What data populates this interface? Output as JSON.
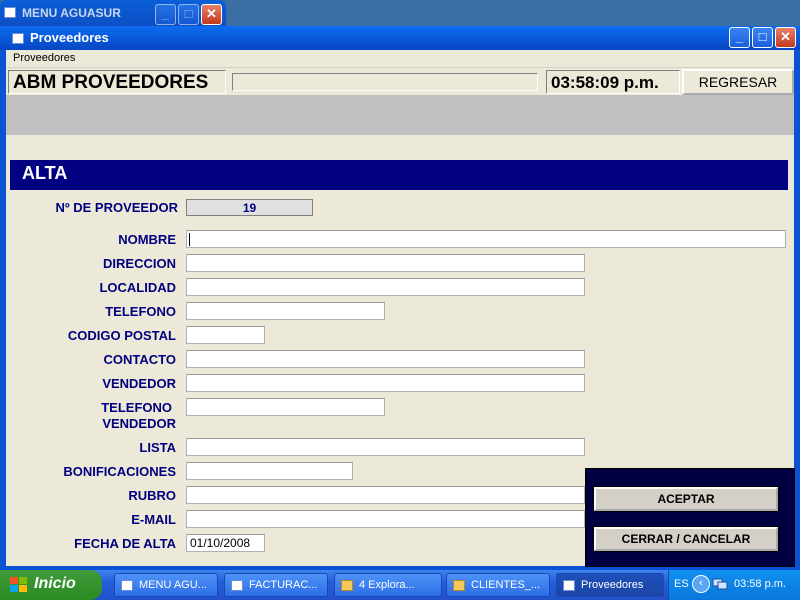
{
  "bg_window": {
    "title": "MENU AGUASUR"
  },
  "window": {
    "title": "Proveedores",
    "min": "_",
    "max": "□",
    "close": "✕"
  },
  "menubar": {
    "items": [
      "Proveedores"
    ]
  },
  "toolbar": {
    "abm_title": "ABM PROVEEDORES",
    "status": "",
    "clock": "03:58:09 p.m.",
    "regresar": "REGRESAR"
  },
  "section": {
    "title": "ALTA"
  },
  "form": {
    "nro_label": "Nº DE PROVEEDOR",
    "nro_value": "19",
    "nombre": "NOMBRE",
    "direccion": "DIRECCION",
    "localidad": "LOCALIDAD",
    "telefono": "TELEFONO",
    "codigo_postal": "CODIGO POSTAL",
    "contacto": "CONTACTO",
    "vendedor": "VENDEDOR",
    "telefono_vendedor_1": "TELEFONO",
    "telefono_vendedor_2": "VENDEDOR",
    "lista": "LISTA",
    "bonificaciones": "BONIFICACIONES",
    "rubro": "RUBRO",
    "email": "E-MAIL",
    "fecha_alta": "FECHA DE ALTA",
    "fecha_alta_value": "01/10/2008"
  },
  "buttons": {
    "aceptar": "ACEPTAR",
    "cerrar": "CERRAR / CANCELAR"
  },
  "taskbar": {
    "start": "Inicio",
    "tasks": [
      "MENU AGU...",
      "FACTURAC...",
      "4 Explora...",
      "CLIENTES_...",
      "Proveedores"
    ],
    "lang": "ES",
    "clock": "03:58 p.m."
  }
}
